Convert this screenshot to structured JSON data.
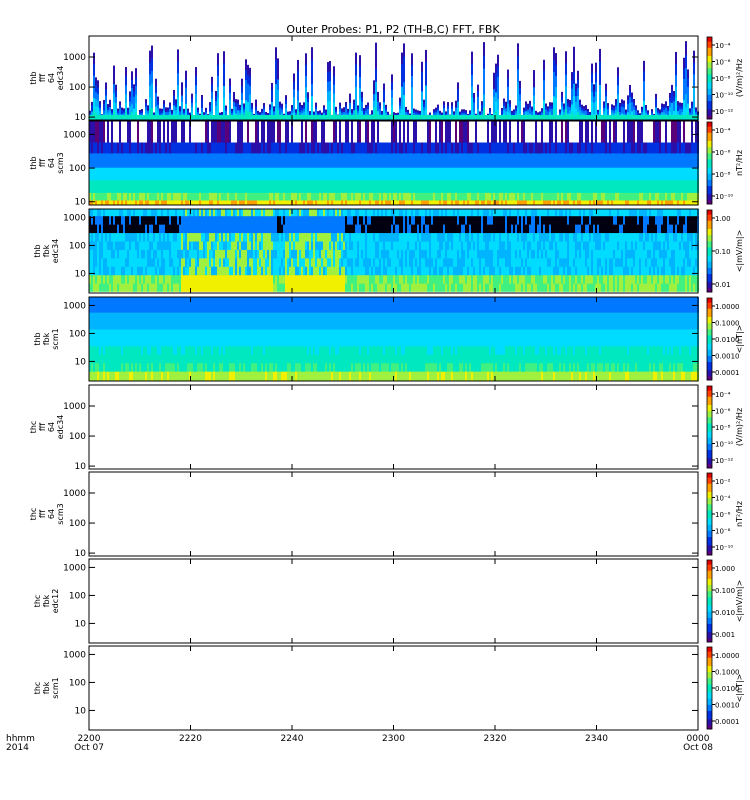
{
  "chart_data": {
    "type": "heatmap",
    "title": "Outer Probes: P1, P2 (TH-B,C) FFT, FBK",
    "x_axis": {
      "corner_label": [
        "hhmm",
        "2014"
      ],
      "ticks": [
        {
          "label": "2200",
          "sub": "Oct 07",
          "t": 0
        },
        {
          "label": "2220",
          "sub": "",
          "t": 20
        },
        {
          "label": "2240",
          "sub": "",
          "t": 40
        },
        {
          "label": "2300",
          "sub": "",
          "t": 60
        },
        {
          "label": "2320",
          "sub": "",
          "t": 80
        },
        {
          "label": "2340",
          "sub": "",
          "t": 100
        },
        {
          "label": "0000",
          "sub": "Oct 08",
          "t": 120
        }
      ],
      "range_minutes": [
        0,
        120
      ]
    },
    "panels": [
      {
        "id": "thb-fff64-edc34",
        "ylabel": [
          "thb",
          "fff",
          "64",
          "edc34"
        ],
        "yticks": [
          "10",
          "100",
          "1000"
        ],
        "ylim": [
          8,
          5000
        ],
        "yscale": "log",
        "cbar_label": "(V/m)²/Hz",
        "cbar_ticks": [
          "10⁻¹²",
          "10⁻¹⁰",
          "10⁻⁸",
          "10⁻⁶",
          "10⁻⁴"
        ],
        "data_present": true,
        "pattern": "fff_e"
      },
      {
        "id": "thb-fff64-scm3",
        "ylabel": [
          "thb",
          "fff",
          "64",
          "scm3"
        ],
        "yticks": [
          "10",
          "100",
          "1000"
        ],
        "ylim": [
          8,
          2500
        ],
        "yscale": "log",
        "cbar_label": "nT²/Hz",
        "cbar_ticks": [
          "10⁻¹⁰",
          "10⁻⁸",
          "10⁻⁶",
          "10⁻⁴"
        ],
        "data_present": true,
        "pattern": "fff_b"
      },
      {
        "id": "thb-fbk-edc34",
        "ylabel": [
          "thb",
          "fbk",
          "edc34"
        ],
        "yticks": [
          "10",
          "100",
          "1000"
        ],
        "ylim": [
          2,
          2000
        ],
        "yscale": "log",
        "cbar_label": "<|mV/m|>",
        "cbar_ticks": [
          "0.01",
          "0.10",
          "1.00"
        ],
        "data_present": true,
        "pattern": "fbk_e"
      },
      {
        "id": "thb-fbk-scm1",
        "ylabel": [
          "thb",
          "fbk",
          "scm1"
        ],
        "yticks": [
          "10",
          "100",
          "1000"
        ],
        "ylim": [
          2,
          2000
        ],
        "yscale": "log",
        "cbar_label": "<|nT|>",
        "cbar_ticks": [
          "0.0001",
          "0.0010",
          "0.0100",
          "0.1000",
          "1.0000"
        ],
        "data_present": true,
        "pattern": "fbk_b"
      },
      {
        "id": "thc-fff64-edc34",
        "ylabel": [
          "thc",
          "fff",
          "64",
          "edc34"
        ],
        "yticks": [
          "10",
          "100",
          "1000"
        ],
        "ylim": [
          8,
          5000
        ],
        "yscale": "log",
        "cbar_label": "(V/m)²/Hz",
        "cbar_ticks": [
          "10⁻¹²",
          "10⁻¹⁰",
          "10⁻⁸",
          "10⁻⁶",
          "10⁻⁴"
        ],
        "data_present": false
      },
      {
        "id": "thc-fff64-scm3",
        "ylabel": [
          "thc",
          "fff",
          "64",
          "scm3"
        ],
        "yticks": [
          "10",
          "100",
          "1000"
        ],
        "ylim": [
          8,
          5000
        ],
        "yscale": "log",
        "cbar_label": "nT²/Hz",
        "cbar_ticks": [
          "10⁻¹⁰",
          "10⁻⁸",
          "10⁻⁶",
          "10⁻⁴",
          "10⁻²"
        ],
        "data_present": false
      },
      {
        "id": "thc-fbk-edc12",
        "ylabel": [
          "thc",
          "fbk",
          "edc12"
        ],
        "yticks": [
          "10",
          "100",
          "1000"
        ],
        "ylim": [
          2,
          2000
        ],
        "yscale": "log",
        "cbar_label": "<|mV/m|>",
        "cbar_ticks": [
          "0.001",
          "0.010",
          "0.100",
          "1.000"
        ],
        "data_present": false
      },
      {
        "id": "thc-fbk-scm1",
        "ylabel": [
          "thc",
          "fbk",
          "scm1"
        ],
        "yticks": [
          "10",
          "100",
          "1000"
        ],
        "ylim": [
          2,
          2000
        ],
        "yscale": "log",
        "cbar_label": "<|nT|>",
        "cbar_ticks": [
          "0.0001",
          "0.0010",
          "0.0100",
          "0.1000",
          "1.0000"
        ],
        "data_present": false
      }
    ],
    "colormap": [
      "#5a0078",
      "#2a10a8",
      "#0030e0",
      "#0078ff",
      "#00b4ff",
      "#00dcff",
      "#00e8c0",
      "#40f080",
      "#a0f040",
      "#f0f000",
      "#ffa000",
      "#ff4000",
      "#e00000"
    ]
  }
}
